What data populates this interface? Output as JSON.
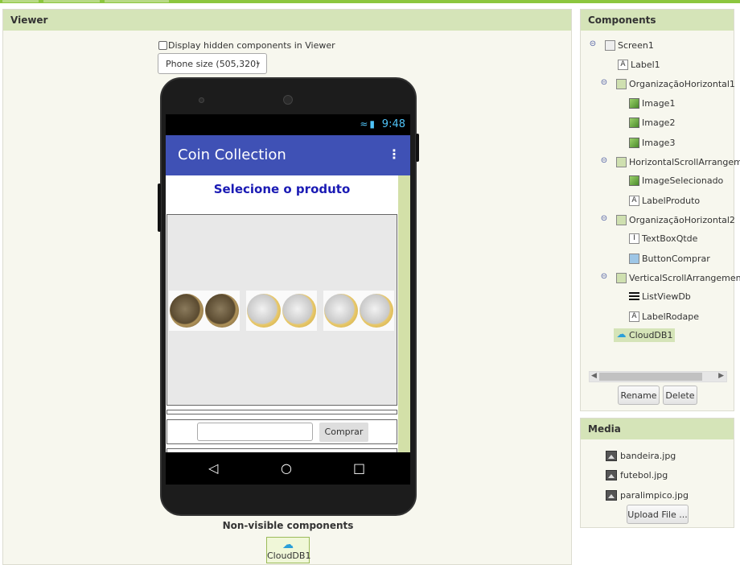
{
  "viewer": {
    "title": "Viewer",
    "hidden_label": "Display hidden components in Viewer",
    "size_select": "Phone size (505,320)",
    "nonvisible_label": "Non-visible components",
    "nonvisible_items": [
      "CloudDB1"
    ]
  },
  "phone": {
    "time": "9:48",
    "app_title": "Coin Collection",
    "selecione": "Selecione o produto",
    "buy_button": "Comprar"
  },
  "components": {
    "title": "Components",
    "tree": [
      {
        "label": "Screen1",
        "icon": "screen-icon"
      },
      {
        "label": "Label1",
        "icon": "label-icon"
      },
      {
        "label": "OrganizaçãoHorizontal1",
        "icon": "arrangement-icon"
      },
      {
        "label": "Image1",
        "icon": "image-icon"
      },
      {
        "label": "Image2",
        "icon": "image-icon"
      },
      {
        "label": "Image3",
        "icon": "image-icon"
      },
      {
        "label": "HorizontalScrollArrangem",
        "icon": "arrangement-icon"
      },
      {
        "label": "ImageSelecionado",
        "icon": "image-icon"
      },
      {
        "label": "LabelProduto",
        "icon": "label-icon"
      },
      {
        "label": "OrganizaçãoHorizontal2",
        "icon": "arrangement-icon"
      },
      {
        "label": "TextBoxQtde",
        "icon": "textbox-icon"
      },
      {
        "label": "ButtonComprar",
        "icon": "button-icon"
      },
      {
        "label": "VerticalScrollArrangemen",
        "icon": "arrangement-icon"
      },
      {
        "label": "ListViewDb",
        "icon": "listview-icon"
      },
      {
        "label": "LabelRodape",
        "icon": "label-icon"
      },
      {
        "label": "CloudDB1",
        "icon": "cloud-icon"
      }
    ],
    "rename": "Rename",
    "delete": "Delete"
  },
  "media": {
    "title": "Media",
    "files": [
      "bandeira.jpg",
      "futebol.jpg",
      "paralimpico.jpg"
    ],
    "upload": "Upload File ..."
  },
  "colors": {
    "accent": "#8cc63f",
    "panel_header": "#d5e4b8",
    "app_bar": "#3f51b5",
    "title_text": "#1a1ab4"
  }
}
